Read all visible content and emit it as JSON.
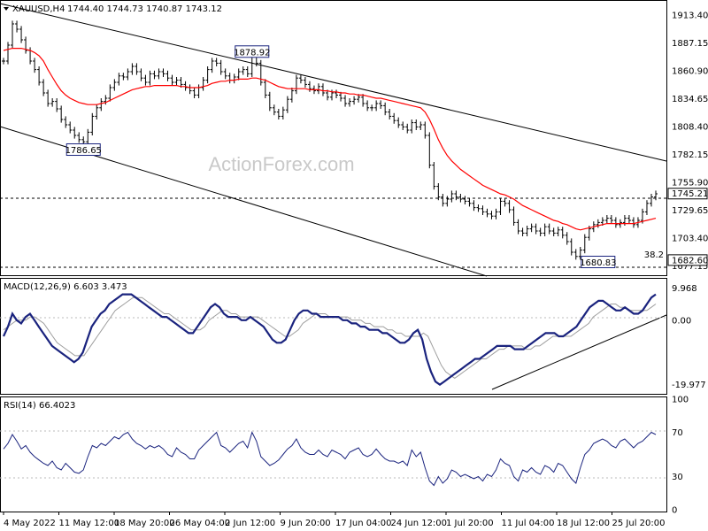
{
  "header": {
    "symbol": "XAUUSD,H4",
    "ohlc": "1744.40 1744.73 1740.87 1743.12",
    "macd_label": "MACD(12,26,9) 6.603 3.473",
    "rsi_label": "RSI(14) 66.4023",
    "watermark": "ActionForex.com"
  },
  "colors": {
    "candles": "#000000",
    "ema": "#ff0000",
    "macd_main": "#1a237e",
    "macd_signal": "#9e9e9e",
    "rsi": "#1a237e",
    "grid": "#bbbbbb"
  },
  "chart_data": [
    {
      "type": "line",
      "panel": "price",
      "ylim": [
        1670,
        1925
      ],
      "yticks": [
        "1913.40",
        "1887.15",
        "1860.90",
        "1834.65",
        "1808.40",
        "1782.15",
        "1755.90",
        "1729.65",
        "1703.40",
        "1677.15"
      ],
      "y_highlight": [
        "1745.21",
        "1682.60"
      ],
      "x_labels": [
        "4 May 2022",
        "11 May 12:00",
        "18 May 20:00",
        "26 May 04:00",
        "2 Jun 12:00",
        "9 Jun 20:00",
        "17 Jun 04:00",
        "24 Jun 12:00",
        "1 Jul 20:00",
        "11 Jul 04:00",
        "18 Jul 12:00",
        "25 Jul 20:00"
      ],
      "annotations": [
        {
          "label": "1786.65",
          "x_index": 18,
          "value": 1786.65
        },
        {
          "label": "1878.92",
          "x_index": 56,
          "value": 1878.92
        },
        {
          "label": "1680.83",
          "x_index": 134,
          "value": 1680.83
        },
        {
          "label": "38.2",
          "value": 1682.6
        }
      ],
      "series": [
        {
          "values": [
            1870,
            1885,
            1905,
            1900,
            1890,
            1880,
            1870,
            1862,
            1850,
            1840,
            1830,
            1832,
            1825,
            1815,
            1810,
            1805,
            1800,
            1796,
            1794,
            1803,
            1818,
            1826,
            1832,
            1835,
            1845,
            1850,
            1856,
            1855,
            1860,
            1865,
            1860,
            1854,
            1850,
            1858,
            1856,
            1860,
            1858,
            1854,
            1850,
            1852,
            1848,
            1845,
            1842,
            1838,
            1845,
            1852,
            1862,
            1870,
            1868,
            1860,
            1856,
            1852,
            1855,
            1860,
            1862,
            1858,
            1875,
            1868,
            1850,
            1838,
            1826,
            1822,
            1818,
            1824,
            1834,
            1842,
            1854,
            1852,
            1848,
            1844,
            1842,
            1846,
            1840,
            1836,
            1840,
            1838,
            1835,
            1830,
            1832,
            1834,
            1836,
            1830,
            1826,
            1826,
            1830,
            1828,
            1822,
            1818,
            1814,
            1810,
            1808,
            1805,
            1812,
            1808,
            1810,
            1800,
            1772,
            1752,
            1742,
            1736,
            1740,
            1745,
            1742,
            1740,
            1738,
            1736,
            1732,
            1731,
            1728,
            1726,
            1724,
            1728,
            1738,
            1736,
            1730,
            1718,
            1710,
            1708,
            1712,
            1714,
            1710,
            1708,
            1714,
            1710,
            1708,
            1711,
            1706,
            1700,
            1690,
            1686,
            1692,
            1704,
            1712,
            1716,
            1718,
            1720,
            1722,
            1720,
            1716,
            1718,
            1722,
            1720,
            1716,
            1720,
            1728,
            1736,
            1742,
            1745
          ]
        },
        {
          "values": [
            1880,
            1881,
            1882,
            1882,
            1882,
            1881,
            1880,
            1878,
            1875,
            1870,
            1862,
            1855,
            1848,
            1842,
            1838,
            1835,
            1833,
            1831,
            1830,
            1829,
            1829,
            1829,
            1830,
            1831,
            1833,
            1835,
            1837,
            1839,
            1841,
            1843,
            1844,
            1845,
            1846,
            1846,
            1847,
            1847,
            1847,
            1847,
            1847,
            1847,
            1846,
            1846,
            1845,
            1845,
            1845,
            1846,
            1847,
            1849,
            1850,
            1851,
            1851,
            1852,
            1852,
            1853,
            1853,
            1853,
            1854,
            1854,
            1853,
            1852,
            1850,
            1848,
            1846,
            1845,
            1844,
            1844,
            1844,
            1844,
            1844,
            1843,
            1843,
            1843,
            1842,
            1842,
            1841,
            1841,
            1840,
            1840,
            1839,
            1839,
            1838,
            1838,
            1837,
            1836,
            1835,
            1835,
            1834,
            1833,
            1832,
            1831,
            1830,
            1829,
            1828,
            1827,
            1826,
            1822,
            1815,
            1806,
            1796,
            1788,
            1781,
            1776,
            1772,
            1768,
            1765,
            1762,
            1759,
            1756,
            1753,
            1751,
            1749,
            1747,
            1745,
            1744,
            1742,
            1740,
            1737,
            1734,
            1732,
            1730,
            1728,
            1726,
            1724,
            1722,
            1720,
            1719,
            1717,
            1716,
            1714,
            1712,
            1711,
            1712,
            1713,
            1714,
            1715,
            1716,
            1717,
            1717,
            1717,
            1717,
            1717,
            1717,
            1717,
            1718,
            1719,
            1720,
            1721,
            1722
          ]
        }
      ]
    },
    {
      "type": "line",
      "panel": "macd",
      "ylim": [
        -22,
        12
      ],
      "yticks": [
        "9.968",
        "0.00",
        "-19.977"
      ],
      "series": [
        {
          "values": [
            -5,
            -2,
            2,
            0,
            -1,
            1,
            2,
            0,
            -2,
            -4,
            -6,
            -8,
            -9,
            -10,
            -11,
            -12,
            -13,
            -12,
            -10,
            -6,
            -2,
            0,
            2,
            3,
            5,
            6,
            7,
            8,
            8,
            8,
            7,
            6,
            5,
            4,
            3,
            2,
            1,
            1,
            0,
            -1,
            -2,
            -3,
            -4,
            -4,
            -2,
            0,
            2,
            4,
            5,
            4,
            2,
            1,
            1,
            1,
            0,
            0,
            1,
            0,
            -1,
            -2,
            -4,
            -6,
            -7,
            -7,
            -6,
            -3,
            0,
            2,
            3,
            3,
            2,
            2,
            1,
            1,
            1,
            1,
            1,
            0,
            0,
            -1,
            -1,
            -2,
            -2,
            -3,
            -3,
            -3,
            -4,
            -4,
            -5,
            -6,
            -7,
            -7,
            -6,
            -4,
            -3,
            -6,
            -12,
            -16,
            -19,
            -20,
            -19,
            -18,
            -17,
            -16,
            -15,
            -14,
            -13,
            -12,
            -12,
            -11,
            -10,
            -9,
            -8,
            -8,
            -8,
            -8,
            -9,
            -9,
            -9,
            -8,
            -7,
            -6,
            -5,
            -4,
            -4,
            -4,
            -5,
            -5,
            -4,
            -3,
            -2,
            0,
            2,
            4,
            5,
            6,
            6,
            5,
            4,
            3,
            3,
            4,
            3,
            2,
            2,
            3,
            5,
            7,
            8
          ]
        },
        {
          "values": [
            -3,
            -2,
            -1,
            0,
            0,
            0,
            1,
            1,
            0,
            -1,
            -3,
            -5,
            -7,
            -8,
            -9,
            -10,
            -11,
            -11,
            -11,
            -9,
            -7,
            -5,
            -3,
            -1,
            1,
            3,
            4,
            5,
            6,
            7,
            7,
            7,
            6,
            5,
            4,
            3,
            2,
            2,
            1,
            0,
            -1,
            -2,
            -3,
            -3,
            -3,
            -2,
            0,
            1,
            2,
            3,
            3,
            2,
            2,
            1,
            1,
            1,
            1,
            1,
            0,
            -1,
            -2,
            -3,
            -4,
            -5,
            -5,
            -4,
            -3,
            -1,
            0,
            1,
            2,
            2,
            2,
            1,
            1,
            1,
            1,
            1,
            0,
            0,
            0,
            -1,
            -1,
            -2,
            -2,
            -2,
            -3,
            -3,
            -4,
            -4,
            -5,
            -5,
            -5,
            -5,
            -4,
            -5,
            -8,
            -11,
            -14,
            -16,
            -17,
            -18,
            -17,
            -16,
            -15,
            -14,
            -13,
            -12,
            -12,
            -11,
            -10,
            -9,
            -9,
            -8,
            -8,
            -8,
            -8,
            -9,
            -9,
            -8,
            -8,
            -7,
            -6,
            -5,
            -5,
            -5,
            -5,
            -5,
            -4,
            -3,
            -2,
            -1,
            1,
            2,
            3,
            4,
            5,
            5,
            4,
            4,
            3,
            3,
            3,
            3,
            3,
            4,
            5
          ]
        }
      ]
    },
    {
      "type": "line",
      "panel": "rsi",
      "ylim": [
        0,
        100
      ],
      "yticks": [
        "100",
        "70",
        "30",
        "0"
      ],
      "series": [
        {
          "values": [
            55,
            60,
            68,
            62,
            55,
            58,
            52,
            48,
            45,
            42,
            40,
            44,
            38,
            36,
            42,
            38,
            34,
            33,
            36,
            48,
            58,
            56,
            60,
            58,
            62,
            66,
            64,
            68,
            70,
            64,
            60,
            58,
            55,
            58,
            56,
            58,
            55,
            50,
            48,
            56,
            52,
            50,
            46,
            46,
            54,
            58,
            62,
            66,
            70,
            58,
            56,
            52,
            56,
            60,
            62,
            56,
            70,
            62,
            48,
            44,
            40,
            42,
            45,
            50,
            55,
            58,
            64,
            56,
            52,
            50,
            50,
            54,
            50,
            48,
            54,
            52,
            50,
            46,
            52,
            54,
            56,
            50,
            48,
            50,
            55,
            50,
            46,
            44,
            44,
            42,
            44,
            40,
            54,
            48,
            52,
            38,
            26,
            22,
            30,
            24,
            28,
            36,
            34,
            30,
            32,
            30,
            28,
            30,
            26,
            32,
            30,
            36,
            46,
            42,
            40,
            30,
            26,
            36,
            34,
            38,
            34,
            32,
            40,
            38,
            34,
            42,
            40,
            34,
            28,
            24,
            38,
            50,
            54,
            60,
            62,
            64,
            62,
            58,
            56,
            62,
            64,
            60,
            56,
            60,
            62,
            66,
            70,
            68
          ]
        }
      ]
    }
  ]
}
